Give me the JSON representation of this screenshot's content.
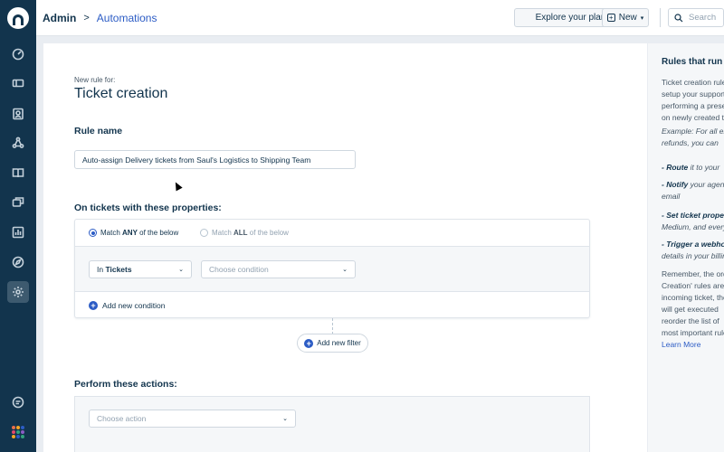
{
  "header": {
    "breadcrumb_root": "Admin",
    "breadcrumb_sep": ">",
    "breadcrumb_current": "Automations",
    "explore_label": "Explore your plan",
    "new_label": "New",
    "search_placeholder": "Search"
  },
  "nav": {
    "items": [
      "dashboard-icon",
      "tickets-icon",
      "contacts-icon",
      "groups-icon",
      "solutions-icon",
      "conversations-icon",
      "reports-icon",
      "discover-icon",
      "settings-icon"
    ],
    "active": "settings-icon",
    "bottom": [
      "chat-icon",
      "apps-grid-icon"
    ]
  },
  "form": {
    "subtitle": "New rule for:",
    "title": "Ticket creation",
    "rule_name_label": "Rule name",
    "rule_name_value": "Auto-assign Delivery tickets from Saul's Logistics to Shipping Team",
    "conditions_label": "On tickets with these properties:",
    "match_any": {
      "prefix": "Match ",
      "strong": "ANY",
      "suffix": " of the below"
    },
    "match_all": {
      "prefix": "Match ",
      "strong": "ALL",
      "suffix": " of the below"
    },
    "in_select": {
      "prefix": "In ",
      "strong": "Tickets"
    },
    "condition_placeholder": "Choose condition",
    "add_condition": "Add new condition",
    "add_filter": "Add new filter",
    "actions_label": "Perform these actions:",
    "action_placeholder": "Choose action"
  },
  "panel": {
    "title": "Rules that run on ticket creation",
    "para1": [
      "Ticket creation rules",
      "setup your support",
      "performing a preset",
      "on newly created tickets"
    ],
    "example": [
      "Example: For all emails about",
      "refunds, you can"
    ],
    "b1": {
      "lead": "- Route",
      "rest": " it to your"
    },
    "b2": {
      "lead": "- Notify",
      "rest": " your agents",
      "line2": "email"
    },
    "b3": {
      "lead": "- Set ticket properties",
      "line2": "Medium, and everything"
    },
    "b4": {
      "lead": "- Trigger a webhook",
      "line2": "details in your billing"
    },
    "para2": [
      "Remember, the order",
      "Creation' rules are",
      "incoming ticket, the",
      "will get executed",
      "reorder the list of",
      "most important rules"
    ],
    "learn_more": "Learn More"
  },
  "colors": {
    "nav_bg": "#12344d",
    "accent": "#2c5cc5",
    "apps_dots": [
      "#e86f4b",
      "#f6a623",
      "#2c5cc5",
      "#e3486b",
      "#33a37d",
      "#8b5cc5",
      "#f6a623",
      "#2c5cc5",
      "#33a37d"
    ]
  }
}
